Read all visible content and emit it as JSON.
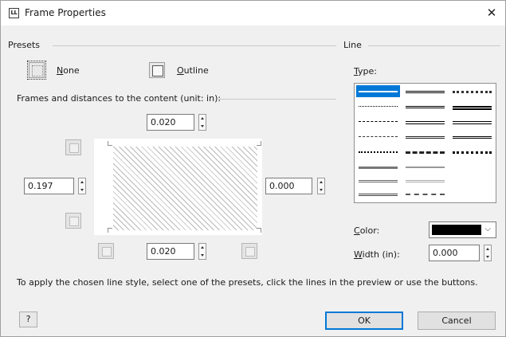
{
  "window": {
    "app_icon_text": "LL",
    "title": "Frame Properties",
    "close_glyph": "✕"
  },
  "presets": {
    "label": "Presets",
    "none": {
      "prefix": "",
      "mnemonic": "N",
      "rest": "one"
    },
    "outline": {
      "prefix": "",
      "mnemonic": "O",
      "rest": "utline"
    }
  },
  "frames": {
    "label": "Frames and distances to the content (unit: in):",
    "top_value": "0.020",
    "left_value": "0.197",
    "right_value": "0.000",
    "bottom_value": "0.020"
  },
  "line": {
    "label": "Line",
    "type_label": {
      "mnemonic": "T",
      "rest": "ype:"
    },
    "color_label": {
      "mnemonic": "C",
      "rest": "olor:"
    },
    "color_value": "#000000",
    "width_label": {
      "mnemonic": "W",
      "rest": "idth (in):"
    },
    "width_value": "0.000",
    "dropdown_icon": "chevron-down-icon",
    "dropdown_glyph": "⌵"
  },
  "hint": "To apply the chosen line style, select one of the presets, click the lines in the preview or use the buttons.",
  "buttons": {
    "help_glyph": "?",
    "ok": "OK",
    "cancel": "Cancel"
  },
  "colors": {
    "accent": "#0078d7",
    "dialog_bg": "#f0f0f0"
  }
}
